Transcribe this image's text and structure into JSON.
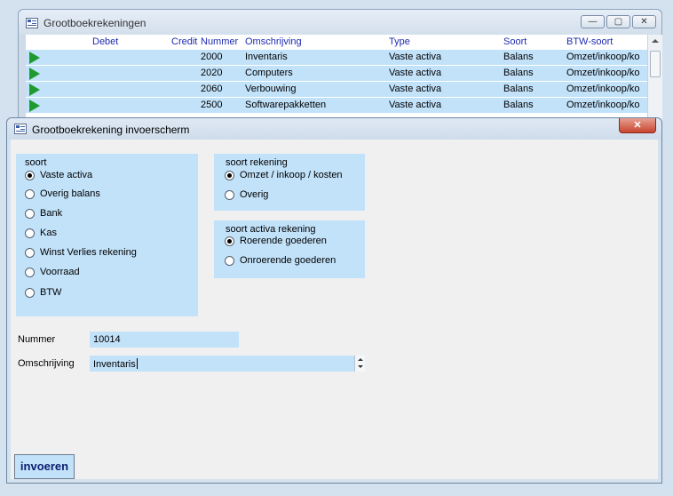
{
  "background_window": {
    "title": "Grootboekrekeningen",
    "controls": {
      "minimize": "—",
      "maximize": "▢",
      "close": "✕"
    },
    "columns": [
      "Debet",
      "Credit",
      "Nummer",
      "Omschrijving",
      "Type",
      "Soort",
      "BTW-soort"
    ],
    "rows": [
      {
        "nummer": "2000",
        "omschrijving": "Inventaris",
        "type": "Vaste activa",
        "soort": "Balans",
        "btw": "Omzet/inkoop/ko"
      },
      {
        "nummer": "2020",
        "omschrijving": "Computers",
        "type": "Vaste activa",
        "soort": "Balans",
        "btw": "Omzet/inkoop/ko"
      },
      {
        "nummer": "2060",
        "omschrijving": "Verbouwing",
        "type": "Vaste activa",
        "soort": "Balans",
        "btw": "Omzet/inkoop/ko"
      },
      {
        "nummer": "2500",
        "omschrijving": "Softwarepakketten",
        "type": "Vaste activa",
        "soort": "Balans",
        "btw": "Omzet/inkoop/ko"
      }
    ]
  },
  "dialog": {
    "title": "Grootboekrekening invoerscherm",
    "close": "✕",
    "soort": {
      "title": "soort",
      "options": [
        "Vaste activa",
        "Overig balans",
        "Bank",
        "Kas",
        "Winst Verlies rekening",
        "Voorraad",
        "BTW"
      ],
      "selected": "Vaste activa"
    },
    "soort_rekening": {
      "title": "soort rekening",
      "options": [
        "Omzet / inkoop / kosten",
        "Overig"
      ],
      "selected": "Omzet / inkoop / kosten"
    },
    "soort_activa": {
      "title": "soort activa rekening",
      "options": [
        "Roerende goederen",
        "Onroerende goederen"
      ],
      "selected": "Roerende goederen"
    },
    "fields": {
      "nummer_label": "Nummer",
      "nummer_value": "10014",
      "omschrijving_label": "Omschrijving",
      "omschrijving_value": "Inventaris"
    },
    "submit": "invoeren"
  },
  "colors": {
    "field_bg": "#c2e2fa",
    "header_text": "#1e2bb0",
    "play_green": "#1f9a2f"
  }
}
